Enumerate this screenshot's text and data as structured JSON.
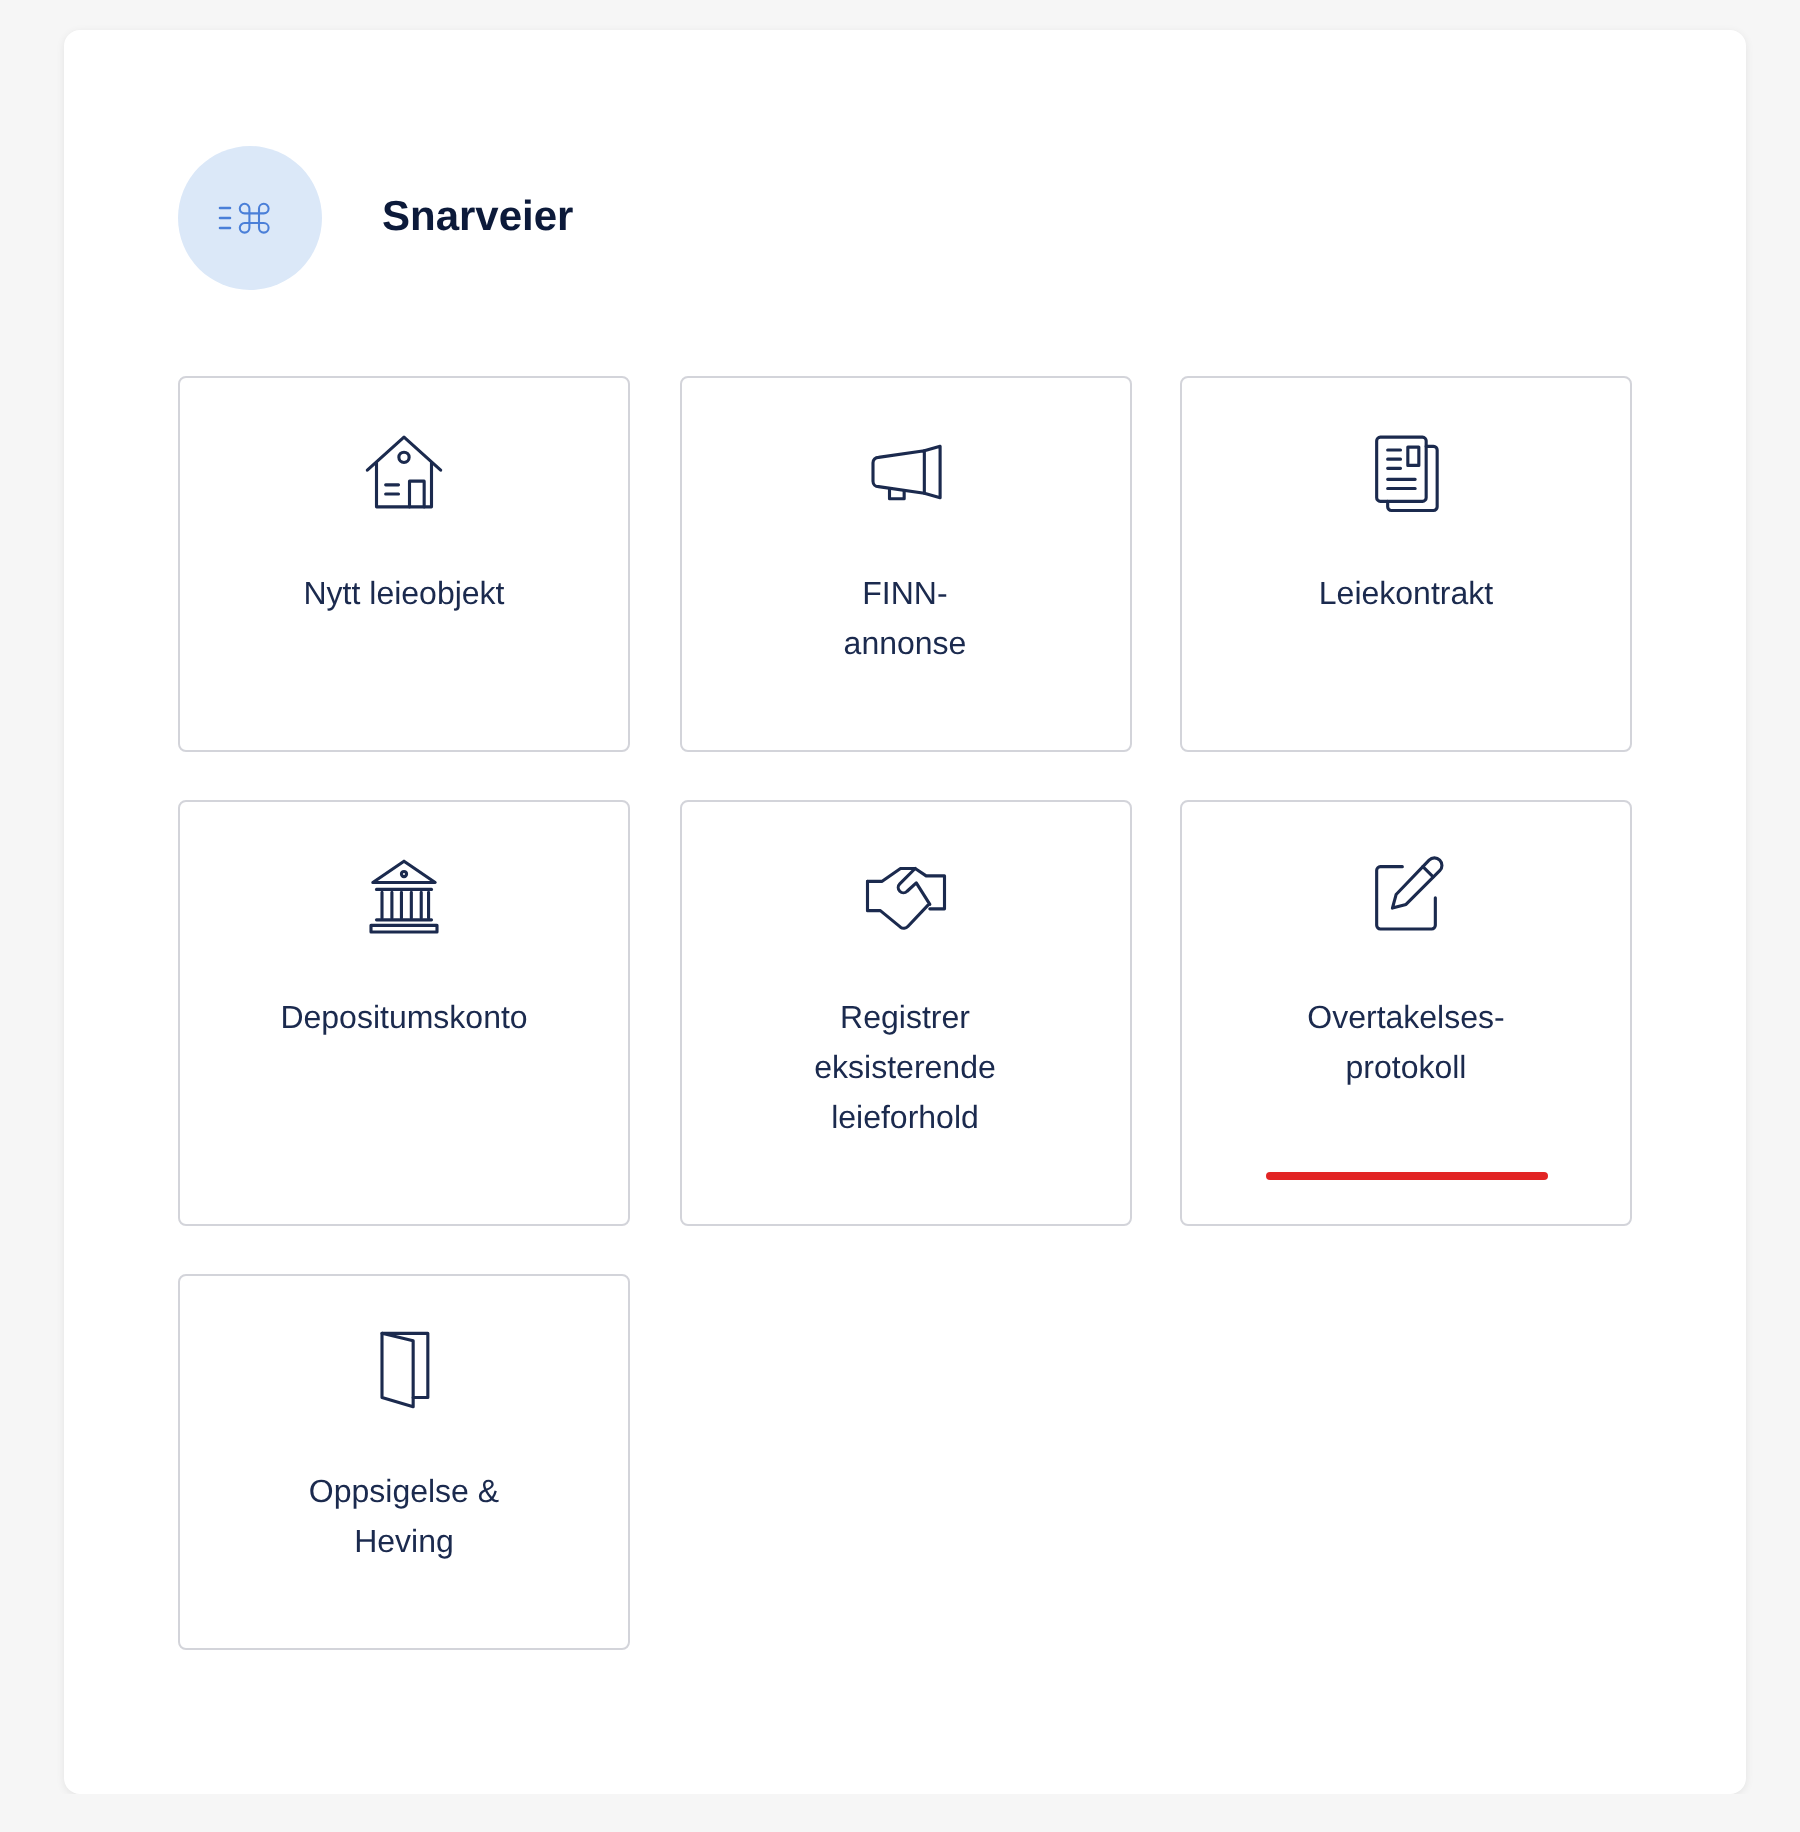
{
  "section": {
    "title": "Snarveier"
  },
  "tiles": [
    {
      "label": "Nytt leieobjekt",
      "selected": false
    },
    {
      "label": "FINN-\nannonse",
      "selected": false
    },
    {
      "label": "Leiekontrakt",
      "selected": false
    },
    {
      "label": "Depositumskonto",
      "selected": false
    },
    {
      "label": "Registrer\neksisterende\nleieforhold",
      "selected": false
    },
    {
      "label": "Overtakelses-\nprotokoll",
      "selected": true
    },
    {
      "label": "Oppsigelse &\nHeving",
      "selected": false
    }
  ]
}
